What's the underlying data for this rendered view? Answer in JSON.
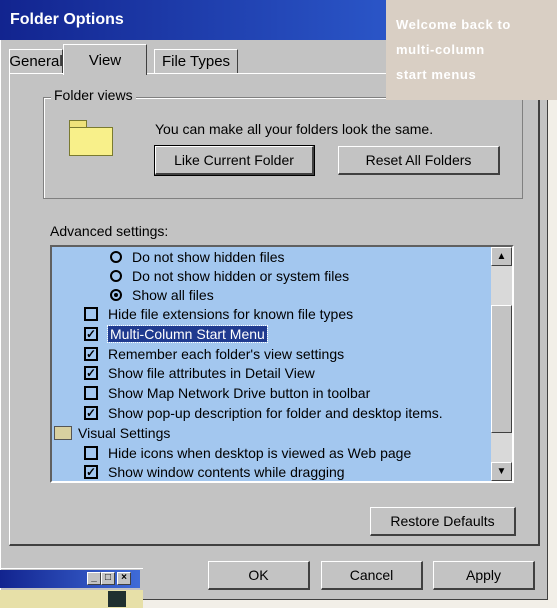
{
  "dialog": {
    "title": "Folder Options",
    "tabs": [
      "General",
      "View",
      "File Types"
    ],
    "active_tab": "View"
  },
  "folder_views": {
    "group_label": "Folder views",
    "description": "You can make all your folders look the same.",
    "like_current_button": "Like Current Folder",
    "reset_all_button": "Reset All Folders"
  },
  "advanced": {
    "label": "Advanced settings:",
    "items": [
      {
        "type": "radio",
        "checked": false,
        "label": "Do not show hidden files"
      },
      {
        "type": "radio",
        "checked": false,
        "label": "Do not show hidden or system files"
      },
      {
        "type": "radio",
        "checked": true,
        "label": "Show all files"
      },
      {
        "type": "check",
        "checked": false,
        "label": "Hide file extensions for known file types"
      },
      {
        "type": "check",
        "checked": true,
        "label": "Multi-Column Start Menu",
        "selected": true
      },
      {
        "type": "check",
        "checked": true,
        "label": "Remember each folder's view settings"
      },
      {
        "type": "check",
        "checked": true,
        "label": "Show file attributes in Detail View"
      },
      {
        "type": "check",
        "checked": false,
        "label": "Show Map Network Drive button in toolbar"
      },
      {
        "type": "check",
        "checked": true,
        "label": "Show pop-up description for folder and desktop items."
      },
      {
        "type": "header",
        "label": "Visual Settings"
      },
      {
        "type": "check",
        "checked": false,
        "label": "Hide icons when desktop is viewed as Web page"
      },
      {
        "type": "check",
        "checked": true,
        "label": "Show window contents while dragging"
      }
    ],
    "restore_button": "Restore Defaults"
  },
  "footer": {
    "ok": "OK",
    "cancel": "Cancel",
    "apply": "Apply"
  },
  "callout": {
    "line1": "Welcome back to",
    "line2": "multi-column",
    "line3": "start menus"
  },
  "mini_window": {
    "controls": [
      "_",
      "□",
      "×"
    ]
  }
}
